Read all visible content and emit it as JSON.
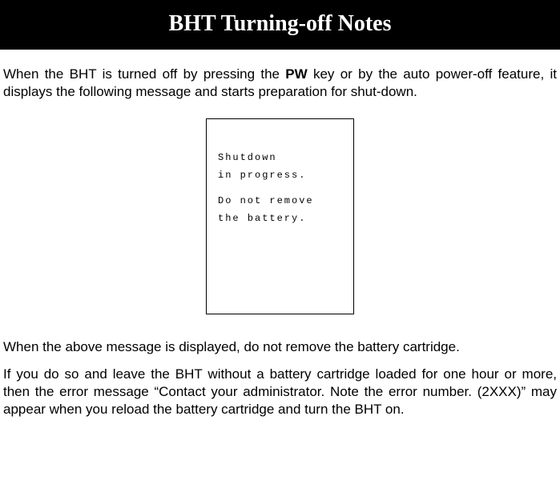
{
  "title": "BHT Turning-off Notes",
  "intro_before_key": "When the BHT is turned off by pressing the ",
  "key_label": "PW",
  "intro_after_key": " key or by the auto power-off feature, it displays the following message and starts preparation for shut-down.",
  "device_line1": "Shutdown",
  "device_line2": "in progress.",
  "device_line3": "Do not remove",
  "device_line4": "the battery.",
  "para2": "When the above message is displayed, do not remove the battery cartridge.",
  "para3": "If you do so and leave the BHT without a battery cartridge loaded for one hour or more, then the error message “Contact your administrator. Note the error number. (2XXX)” may appear when you reload the battery cartridge and turn the BHT on."
}
